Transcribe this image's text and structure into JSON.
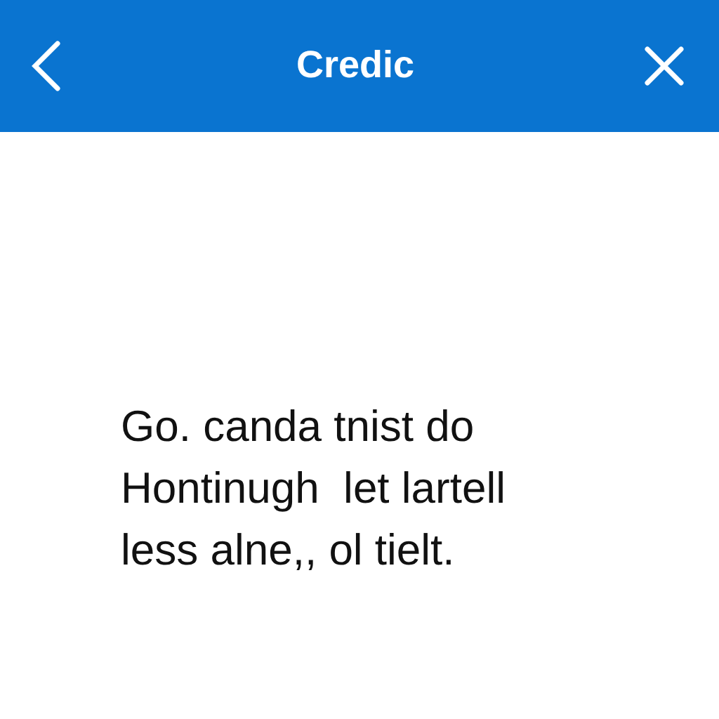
{
  "header": {
    "title": "Credic"
  },
  "message": {
    "lines": [
      "Go. canda tnist do",
      "Hontinugh  let lartell",
      "less alne,, ol tielt."
    ]
  }
}
